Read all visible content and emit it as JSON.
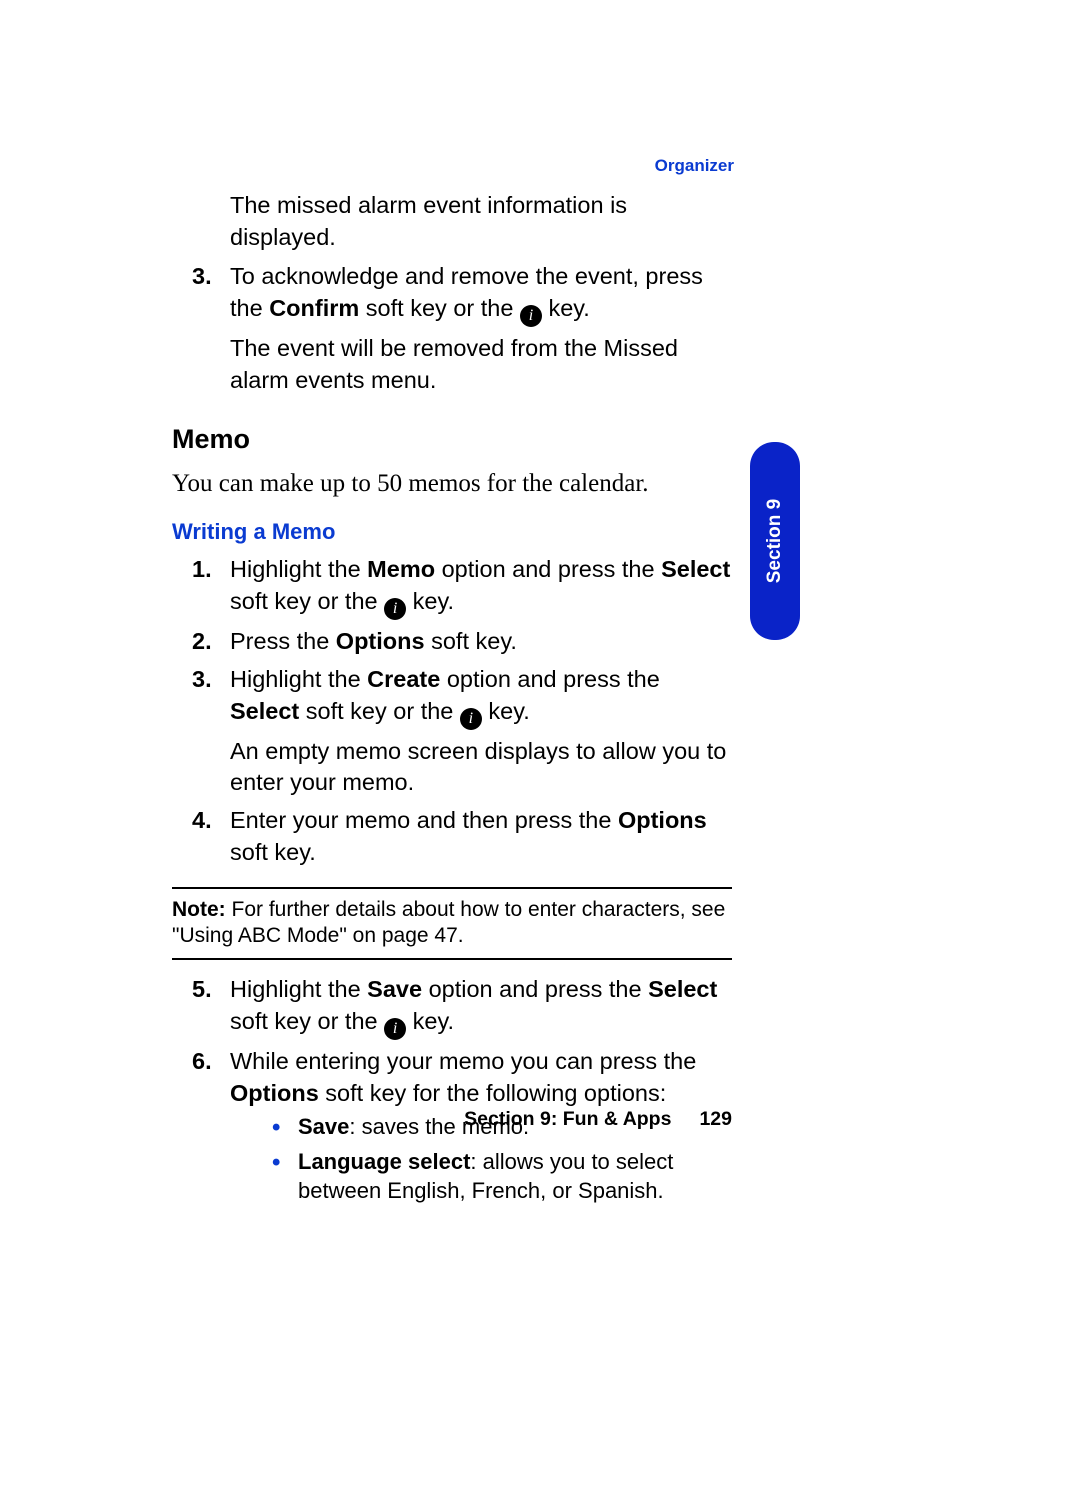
{
  "header": {
    "section_label": "Organizer"
  },
  "intro_lines": {
    "missed_alarm_info": "The missed alarm event information is displayed."
  },
  "ack_step": {
    "number": "3.",
    "part_a": " To acknowledge and remove the event, press the ",
    "confirm_bold": "Confirm",
    "part_b": " soft key or the ",
    "part_c": " key.",
    "continuation": "The event will be removed from the Missed alarm events menu."
  },
  "memo": {
    "heading": "Memo",
    "intro": "You can make up to 50 memos for the calendar.",
    "sub_heading": "Writing a Memo"
  },
  "steps": [
    {
      "number": "1.",
      "frag_a": "Highlight the ",
      "bold_a": "Memo",
      "frag_b": " option and press the ",
      "bold_b": "Select",
      "frag_c": " soft key or the ",
      "has_icon": true,
      "frag_d": " key."
    },
    {
      "number": "2.",
      "frag_a": "Press the ",
      "bold_a": "Options",
      "frag_b": " soft key."
    },
    {
      "number": "3.",
      "frag_a": "Highlight the ",
      "bold_a": "Create",
      "frag_b": " option and press the ",
      "bold_b": "Select",
      "frag_c": " soft key or the ",
      "has_icon": true,
      "frag_d": " key.",
      "continuation": "An empty memo screen displays to allow you to enter your memo."
    },
    {
      "number": "4.",
      "frag_a": "Enter your memo and then press the ",
      "bold_a": "Options",
      "frag_b": " soft key."
    }
  ],
  "note": {
    "label": "Note:",
    "text": " For further details about how to enter characters, see \"Using ABC Mode\" on page 47."
  },
  "steps_after": [
    {
      "number": "5.",
      "frag_a": "Highlight the ",
      "bold_a": "Save",
      "frag_b": " option and press the ",
      "bold_b": "Select",
      "frag_c": " soft key or the ",
      "has_icon": true,
      "frag_d": " key."
    },
    {
      "number": "6.",
      "frag_a": "While entering your memo you can press the ",
      "bold_a": "Options",
      "frag_b": " soft key for the following options:"
    }
  ],
  "bullets": [
    {
      "bold": "Save",
      "rest": ": saves the memo."
    },
    {
      "bold": "Language select",
      "rest": ": allows you to select between English, French, or Spanish."
    }
  ],
  "tab": {
    "label": "Section 9"
  },
  "footer": {
    "section": "Section 9: Fun & Apps",
    "page": "129"
  },
  "icon_glyph": "i"
}
